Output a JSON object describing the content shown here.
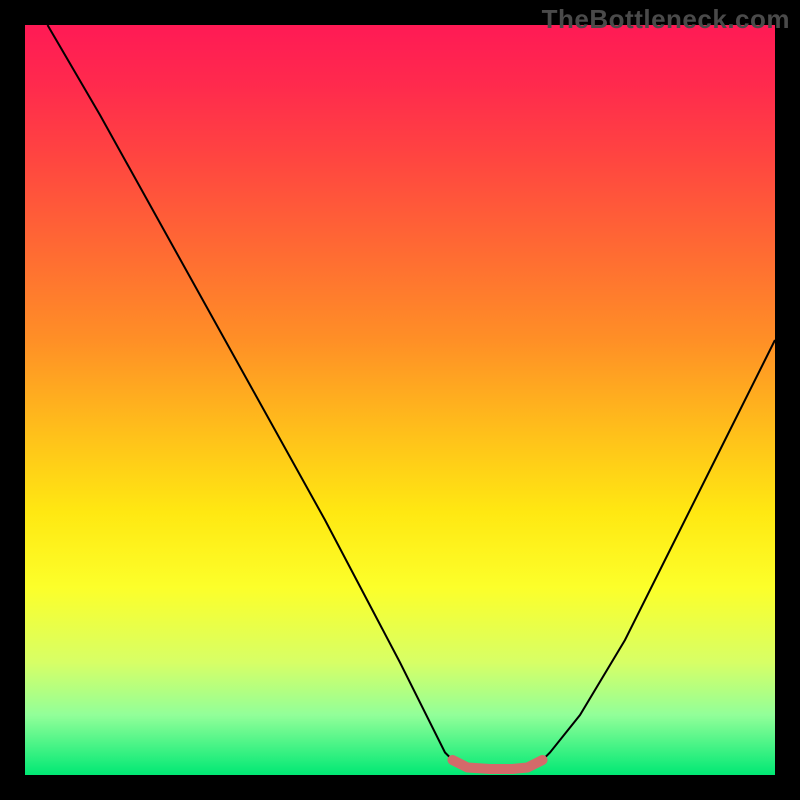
{
  "watermark": "TheBottleneck.com",
  "chart_data": {
    "type": "line",
    "title": "",
    "xlabel": "",
    "ylabel": "",
    "xlim": [
      0,
      100
    ],
    "ylim": [
      0,
      100
    ],
    "series": [
      {
        "name": "left-curve",
        "x": [
          3,
          10,
          20,
          30,
          40,
          50,
          56,
          58
        ],
        "values": [
          100,
          88,
          70,
          52,
          34,
          15,
          3,
          1
        ],
        "color": "#000000"
      },
      {
        "name": "right-curve",
        "x": [
          68,
          70,
          74,
          80,
          86,
          92,
          100
        ],
        "values": [
          1,
          3,
          8,
          18,
          30,
          42,
          58
        ],
        "color": "#000000"
      },
      {
        "name": "bottom-band",
        "x": [
          57,
          59,
          62,
          65,
          67,
          69
        ],
        "values": [
          2,
          1,
          0.8,
          0.8,
          1,
          2
        ],
        "color": "#d46a6a"
      }
    ],
    "gradient_stops": [
      {
        "pos": 0,
        "color": "#ff1a55"
      },
      {
        "pos": 8,
        "color": "#ff2a4d"
      },
      {
        "pos": 18,
        "color": "#ff4640"
      },
      {
        "pos": 30,
        "color": "#ff6a33"
      },
      {
        "pos": 42,
        "color": "#ff8f26"
      },
      {
        "pos": 55,
        "color": "#ffc21a"
      },
      {
        "pos": 65,
        "color": "#ffe812"
      },
      {
        "pos": 75,
        "color": "#fcff2a"
      },
      {
        "pos": 85,
        "color": "#d7ff66"
      },
      {
        "pos": 92,
        "color": "#92ff99"
      },
      {
        "pos": 100,
        "color": "#00e874"
      }
    ]
  }
}
